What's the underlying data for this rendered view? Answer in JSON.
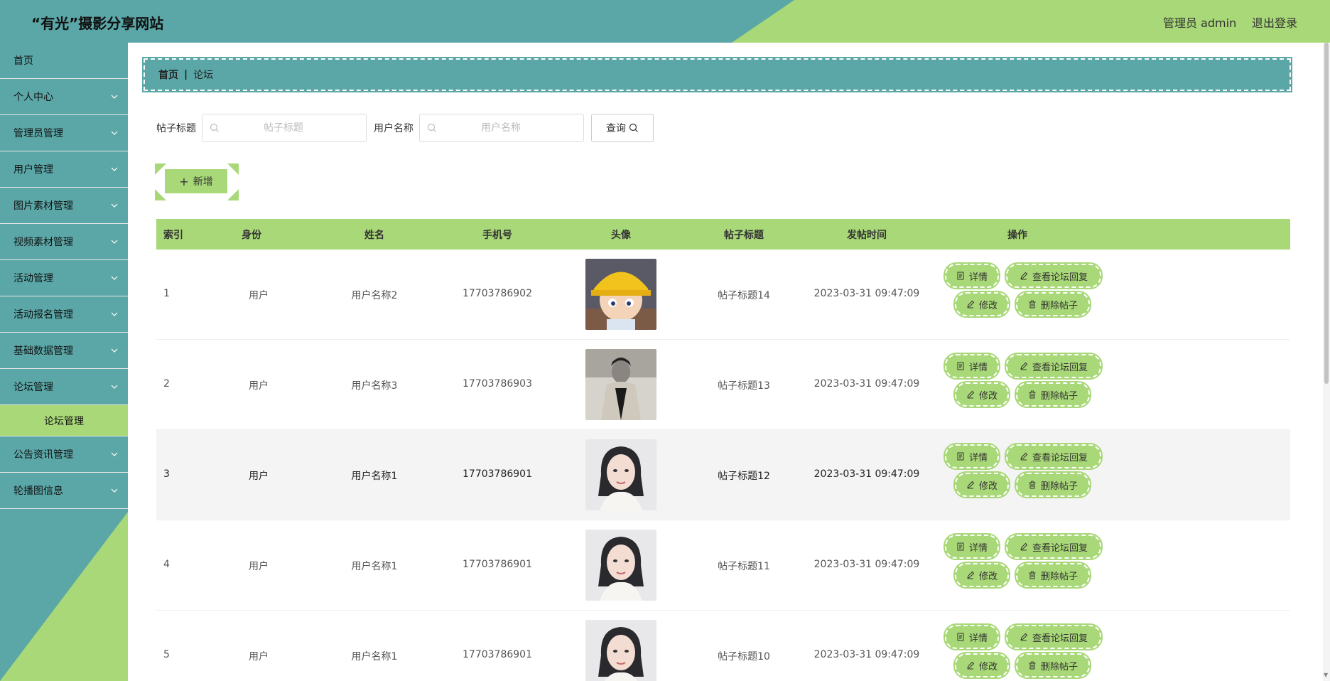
{
  "header": {
    "title": "“有光”摄影分享网站",
    "user": "管理员 admin",
    "logout": "退出登录"
  },
  "sidebar": {
    "items": [
      {
        "label": "首页",
        "expandable": false
      },
      {
        "label": "个人中心",
        "expandable": true
      },
      {
        "label": "管理员管理",
        "expandable": true
      },
      {
        "label": "用户管理",
        "expandable": true
      },
      {
        "label": "图片素材管理",
        "expandable": true
      },
      {
        "label": "视频素材管理",
        "expandable": true
      },
      {
        "label": "活动管理",
        "expandable": true
      },
      {
        "label": "活动报名管理",
        "expandable": true
      },
      {
        "label": "基础数据管理",
        "expandable": true
      },
      {
        "label": "论坛管理",
        "expandable": true,
        "expanded": true
      },
      {
        "label": "公告资讯管理",
        "expandable": true
      },
      {
        "label": "轮播图信息",
        "expandable": true
      }
    ],
    "active_sub": "论坛管理"
  },
  "breadcrumb": {
    "home": "首页",
    "separator": "|",
    "current": "论坛"
  },
  "search": {
    "title_label": "帖子标题",
    "title_placeholder": "帖子标题",
    "user_label": "用户名称",
    "user_placeholder": "用户名称",
    "query_button": "查询"
  },
  "add_button": "新增",
  "table": {
    "headers": [
      "索引",
      "身份",
      "姓名",
      "手机号",
      "头像",
      "帖子标题",
      "发帖时间",
      "操作"
    ],
    "rows": [
      {
        "index": "1",
        "role": "用户",
        "name": "用户名称2",
        "phone": "17703786902",
        "avatar": "cartoon-boy-yellow-hat",
        "title": "帖子标题14",
        "time": "2023-03-31 09:47:09"
      },
      {
        "index": "2",
        "role": "用户",
        "name": "用户名称3",
        "phone": "17703786903",
        "avatar": "man-black-white",
        "title": "帖子标题13",
        "time": "2023-03-31 09:47:09"
      },
      {
        "index": "3",
        "role": "用户",
        "name": "用户名称1",
        "phone": "17703786901",
        "avatar": "woman-portrait",
        "title": "帖子标题12",
        "time": "2023-03-31 09:47:09"
      },
      {
        "index": "4",
        "role": "用户",
        "name": "用户名称1",
        "phone": "17703786901",
        "avatar": "woman-portrait",
        "title": "帖子标题11",
        "time": "2023-03-31 09:47:09"
      },
      {
        "index": "5",
        "role": "用户",
        "name": "用户名称1",
        "phone": "17703786901",
        "avatar": "woman-portrait",
        "title": "帖子标题10",
        "time": "2023-03-31 09:47:09"
      }
    ],
    "actions": {
      "detail": "详情",
      "view_replies": "查看论坛回复",
      "edit": "修改",
      "delete": "删除帖子"
    }
  },
  "colors": {
    "teal": "#5ba7a8",
    "green": "#a8d877"
  }
}
